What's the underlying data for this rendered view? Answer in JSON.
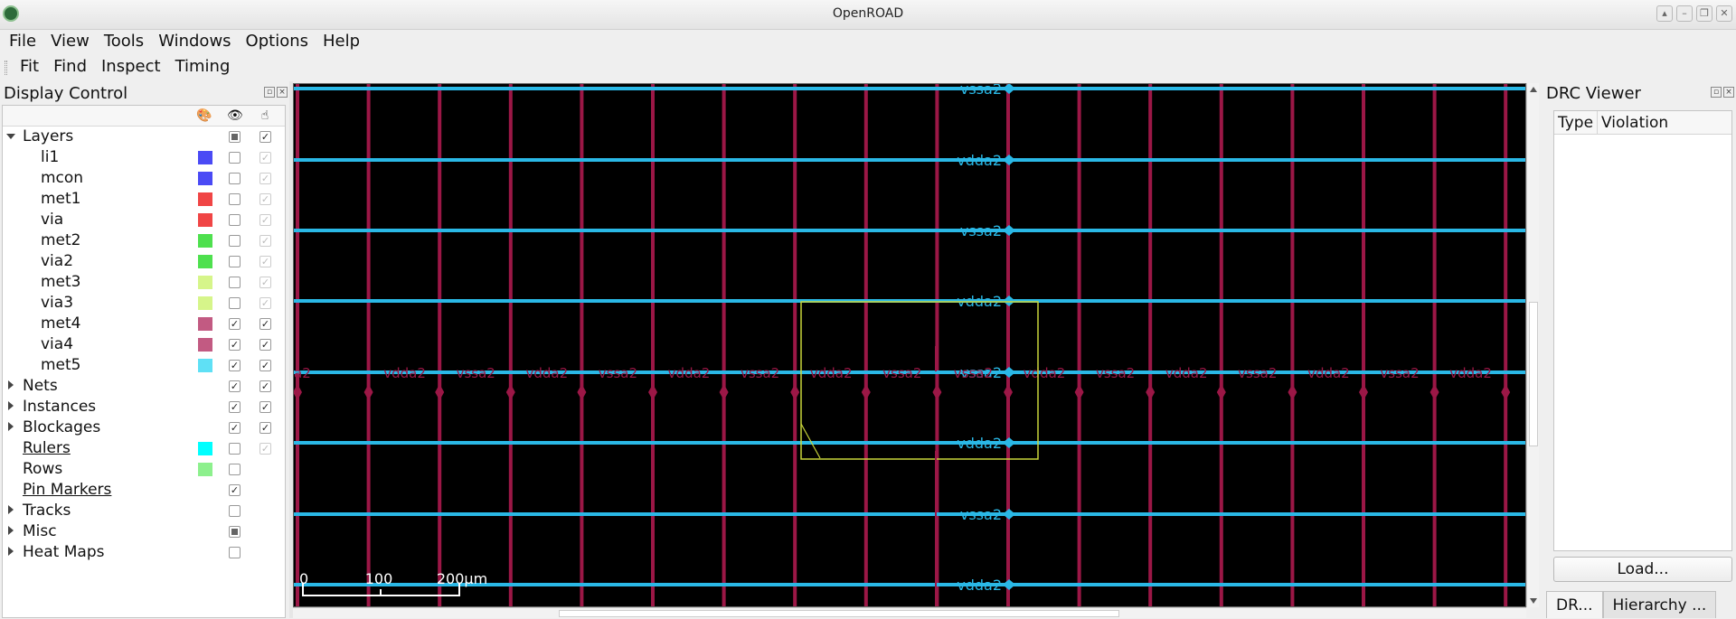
{
  "window": {
    "title": "OpenROAD"
  },
  "menubar": [
    "File",
    "View",
    "Tools",
    "Windows",
    "Options",
    "Help"
  ],
  "toolbar": [
    "Fit",
    "Find",
    "Inspect",
    "Timing"
  ],
  "display_control": {
    "title": "Display Control",
    "header_icons": [
      "palette-icon",
      "eye-icon",
      "pointer-hand-icon"
    ],
    "rows": [
      {
        "label": "Layers",
        "level": 0,
        "expander": "down",
        "visible": "partial",
        "selectable": "checked"
      },
      {
        "label": "li1",
        "level": 1,
        "color": "#4a4af5",
        "visible": "unchecked",
        "selectable": "checked-dim"
      },
      {
        "label": "mcon",
        "level": 1,
        "color": "#4a4af5",
        "visible": "unchecked",
        "selectable": "checked-dim"
      },
      {
        "label": "met1",
        "level": 1,
        "color": "#f04545",
        "visible": "unchecked",
        "selectable": "checked-dim"
      },
      {
        "label": "via",
        "level": 1,
        "color": "#f04545",
        "visible": "unchecked",
        "selectable": "checked-dim"
      },
      {
        "label": "met2",
        "level": 1,
        "color": "#4ee04e",
        "visible": "unchecked",
        "selectable": "checked-dim"
      },
      {
        "label": "via2",
        "level": 1,
        "color": "#4ee04e",
        "visible": "unchecked",
        "selectable": "checked-dim"
      },
      {
        "label": "met3",
        "level": 1,
        "color": "#d6f58a",
        "visible": "unchecked",
        "selectable": "checked-dim"
      },
      {
        "label": "via3",
        "level": 1,
        "color": "#d6f58a",
        "visible": "unchecked",
        "selectable": "checked-dim"
      },
      {
        "label": "met4",
        "level": 1,
        "color": "#c25a82",
        "visible": "checked",
        "selectable": "checked"
      },
      {
        "label": "via4",
        "level": 1,
        "color": "#c25a82",
        "visible": "checked",
        "selectable": "checked"
      },
      {
        "label": "met5",
        "level": 1,
        "color": "#5fe0f5",
        "visible": "checked",
        "selectable": "checked"
      },
      {
        "label": "Nets",
        "level": 0,
        "expander": "right",
        "visible": "checked",
        "selectable": "checked"
      },
      {
        "label": "Instances",
        "level": 0,
        "expander": "right",
        "visible": "checked",
        "selectable": "checked"
      },
      {
        "label": "Blockages",
        "level": 0,
        "expander": "right",
        "visible": "checked",
        "selectable": "checked"
      },
      {
        "label": "Rulers",
        "level": 0,
        "link": true,
        "color": "#00ffff",
        "visible": "unchecked",
        "selectable": "checked-dim"
      },
      {
        "label": "Rows",
        "level": 0,
        "color": "#8df08d",
        "visible": "unchecked"
      },
      {
        "label": "Pin Markers",
        "level": 0,
        "link": true,
        "visible": "checked"
      },
      {
        "label": "Tracks",
        "level": 0,
        "expander": "right",
        "visible": "unchecked"
      },
      {
        "label": "Misc",
        "level": 0,
        "expander": "right",
        "visible": "partial"
      },
      {
        "label": "Heat Maps",
        "level": 0,
        "expander": "right",
        "visible": "unchecked"
      }
    ]
  },
  "layout_view": {
    "colors": {
      "background": "#000000",
      "horizontal_stripe": "#2ab8e6",
      "vertical_stripe": "#9b1746",
      "selection": "#c9d63a"
    },
    "row_labels": [
      "vssa2",
      "vdda2",
      "vssa2",
      "vdda2",
      "vssa2",
      "vdda2",
      "vssa2",
      "vdda2"
    ],
    "pin_labels": [
      "a2",
      "vdda2",
      "vssa2",
      "vdda2",
      "vssa2",
      "vdda2",
      "vssa2",
      "vdda2",
      "vssa2",
      "vssa2",
      "vdda2",
      "vssa2",
      "vdda2",
      "vssa2",
      "vdda2",
      "vssa2",
      "vdda2"
    ],
    "scale_bar": {
      "labels": [
        "0",
        "100",
        "200μm"
      ]
    }
  },
  "drc_viewer": {
    "title": "DRC Viewer",
    "columns": [
      "Type",
      "Violation"
    ],
    "load_button": "Load..."
  },
  "bottom_tabs": [
    "DR...",
    "Hierarchy ..."
  ]
}
